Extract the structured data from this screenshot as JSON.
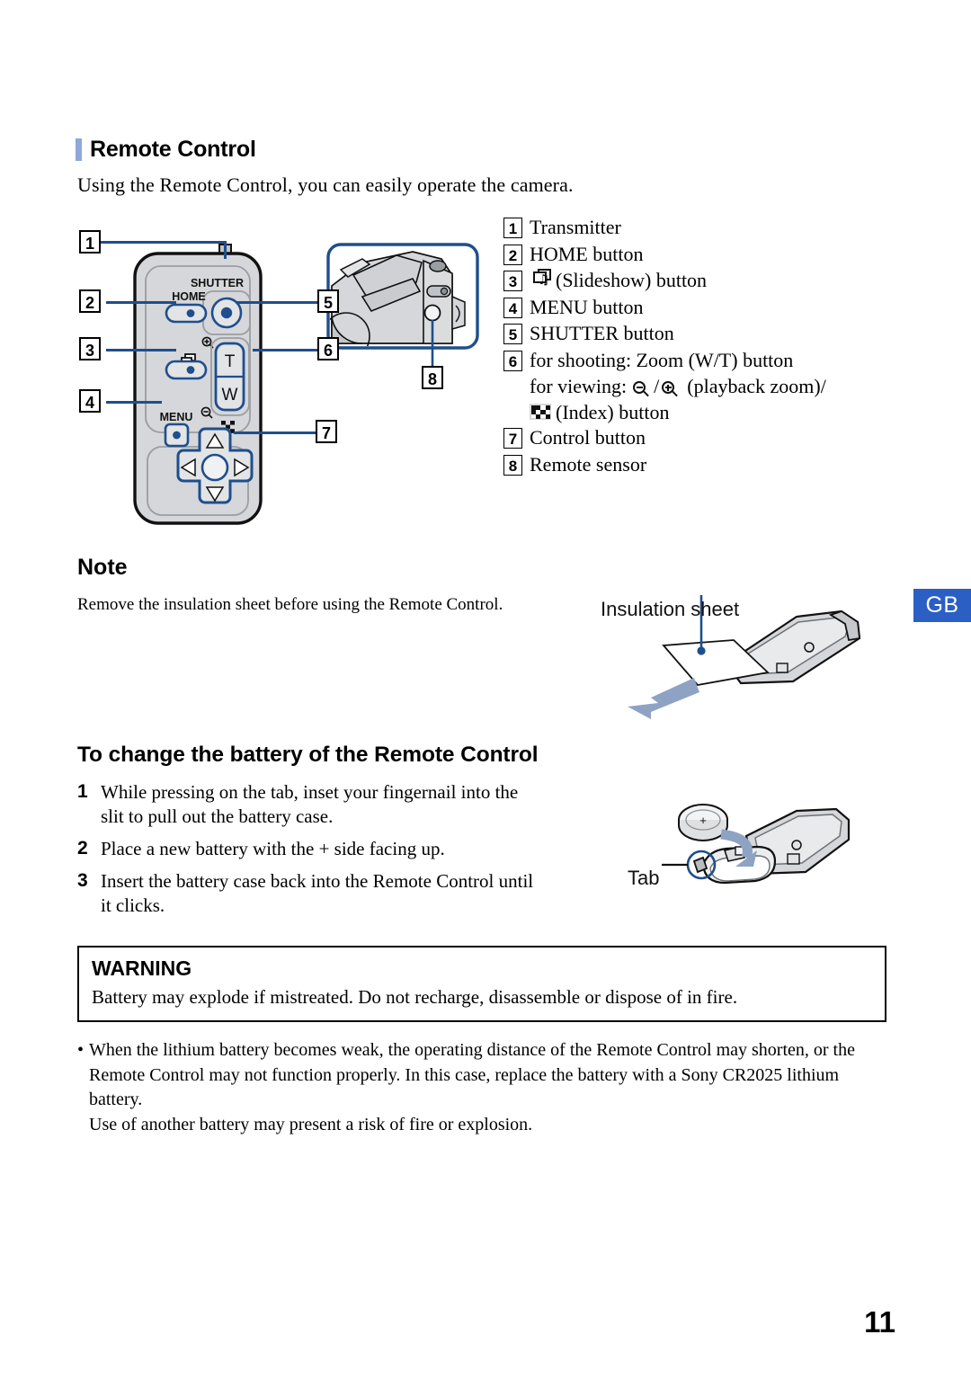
{
  "page": {
    "number": "11",
    "language_tab": "GB"
  },
  "section": {
    "heading": "Remote Control",
    "intro": "Using the Remote Control, you can easily operate the camera."
  },
  "legend": {
    "items": [
      {
        "num": "1",
        "label": "Transmitter",
        "icon": null
      },
      {
        "num": "2",
        "label": "HOME button",
        "icon": null
      },
      {
        "num": "3",
        "label": "(Slideshow) button",
        "icon": "slideshow-icon"
      },
      {
        "num": "4",
        "label": "MENU button",
        "icon": null
      },
      {
        "num": "5",
        "label": "SHUTTER button",
        "icon": null
      },
      {
        "num": "6",
        "label": "for shooting: Zoom (W/T) button",
        "icon": null
      },
      {
        "num": "7",
        "label": "Control button",
        "icon": null
      },
      {
        "num": "8",
        "label": "Remote sensor",
        "icon": null
      }
    ],
    "item6_line2_prefix": "for viewing:",
    "item6_line2_suffix": "(playback zoom)/",
    "item6_line3": "(Index) button"
  },
  "remote_diagram": {
    "callouts": [
      "1",
      "2",
      "3",
      "4",
      "5",
      "6",
      "7"
    ],
    "button_labels": {
      "shutter": "SHUTTER",
      "home": "HOME",
      "menu": "MENU",
      "zoom_tele": "T",
      "zoom_wide": "W"
    }
  },
  "camera_diagram": {
    "callout": "8"
  },
  "note": {
    "heading": "Note",
    "body": "Remove the insulation sheet before using the Remote Control."
  },
  "insulation_figure": {
    "label": "Insulation sheet"
  },
  "battery_section": {
    "heading": "To change the battery of the Remote Control",
    "steps": [
      {
        "num": "1",
        "text": "While pressing on the tab, inset your fingernail into the slit to pull out the battery case."
      },
      {
        "num": "2",
        "text": "Place a new battery with the + side facing up."
      },
      {
        "num": "3",
        "text": "Insert the battery case back into the Remote Control until it clicks."
      }
    ]
  },
  "battery_figure": {
    "tab_label": "Tab",
    "battery_plus": "+"
  },
  "warning": {
    "title": "WARNING",
    "text": "Battery may explode if mistreated. Do not recharge, disassemble or dispose of in fire."
  },
  "bullet": {
    "marker": "•",
    "paragraph": "When the lithium battery becomes weak, the operating distance of the Remote Control may shorten, or the Remote Control may not function properly. In this case, replace the battery with a Sony CR2025 lithium battery.",
    "paragraph2": "Use of another battery may present a risk of fire or explosion."
  },
  "colors": {
    "heading_bar": "#8fa8d8",
    "callout_line": "#1f4e8c",
    "gb_badge": "#2b5fc4",
    "illustration_fill": "#d5d7da"
  }
}
